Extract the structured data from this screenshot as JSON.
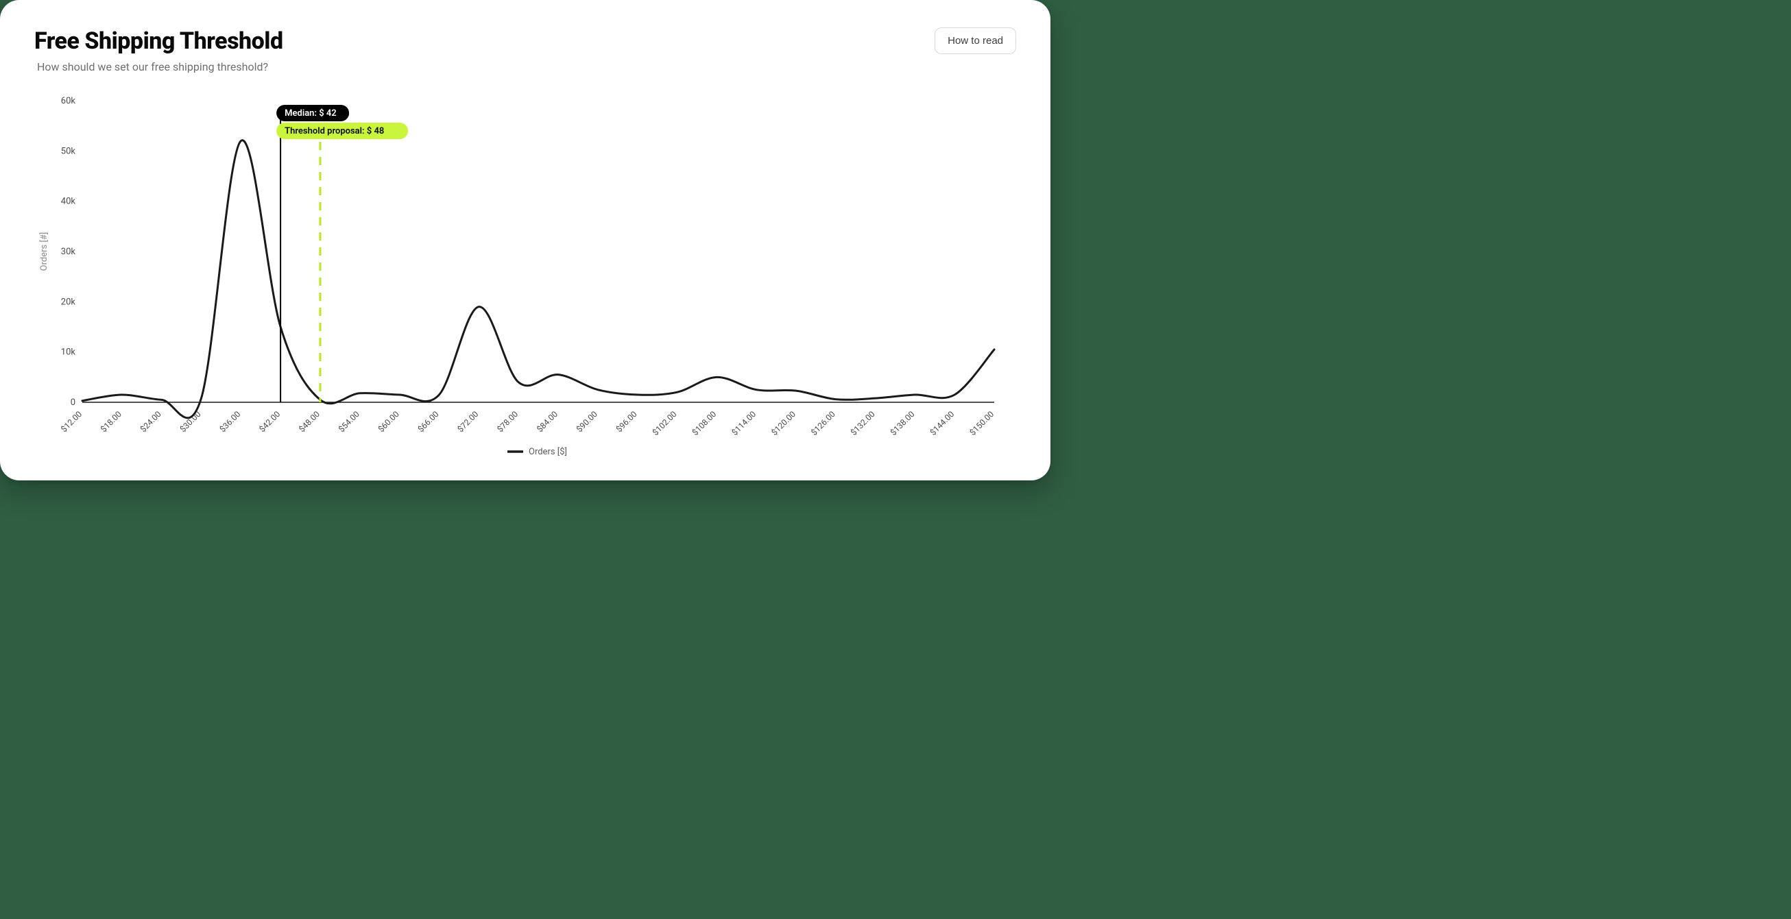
{
  "header": {
    "title": "Free Shipping Threshold",
    "subtitle": "How should we set our free shipping threshold?",
    "how_to_read_label": "How to read"
  },
  "chart_data": {
    "type": "line",
    "x": [
      12,
      18,
      24,
      30,
      36,
      42,
      48,
      54,
      60,
      66,
      72,
      78,
      84,
      90,
      96,
      102,
      108,
      114,
      120,
      126,
      132,
      138,
      144,
      150
    ],
    "values": [
      300,
      1500,
      500,
      800,
      52000,
      15000,
      500,
      1800,
      1500,
      1500,
      19000,
      4000,
      5500,
      2500,
      1500,
      2000,
      5000,
      2500,
      2300,
      600,
      800,
      1500,
      1500,
      10500
    ],
    "x_tick_labels": [
      "$12.00",
      "$18.00",
      "$24.00",
      "$30.00",
      "$36.00",
      "$42.00",
      "$48.00",
      "$54.00",
      "$60.00",
      "$66.00",
      "$72.00",
      "$78.00",
      "$84.00",
      "$90.00",
      "$96.00",
      "$102.00",
      "$108.00",
      "$114.00",
      "$120.00",
      "$126.00",
      "$132.00",
      "$138.00",
      "$144.00",
      "$150.00"
    ],
    "y_ticks": [
      0,
      10000,
      20000,
      30000,
      40000,
      50000,
      60000
    ],
    "y_tick_labels": [
      "0",
      "10k",
      "20k",
      "30k",
      "40k",
      "50k",
      "60k"
    ],
    "ylabel": "Orders [#]",
    "legend_label": "Orders [$]",
    "median": {
      "value": 42,
      "label": "Median: $ 42"
    },
    "threshold": {
      "value": 48,
      "label": "Threshold proposal: $ 48"
    },
    "xlim": [
      12,
      150
    ],
    "ylim": [
      0,
      60000
    ],
    "line_color": "#1a1a1a",
    "median_pill_color": "#000000",
    "threshold_pill_color": "#c9f53c",
    "threshold_line_color": "#b9e81c"
  }
}
